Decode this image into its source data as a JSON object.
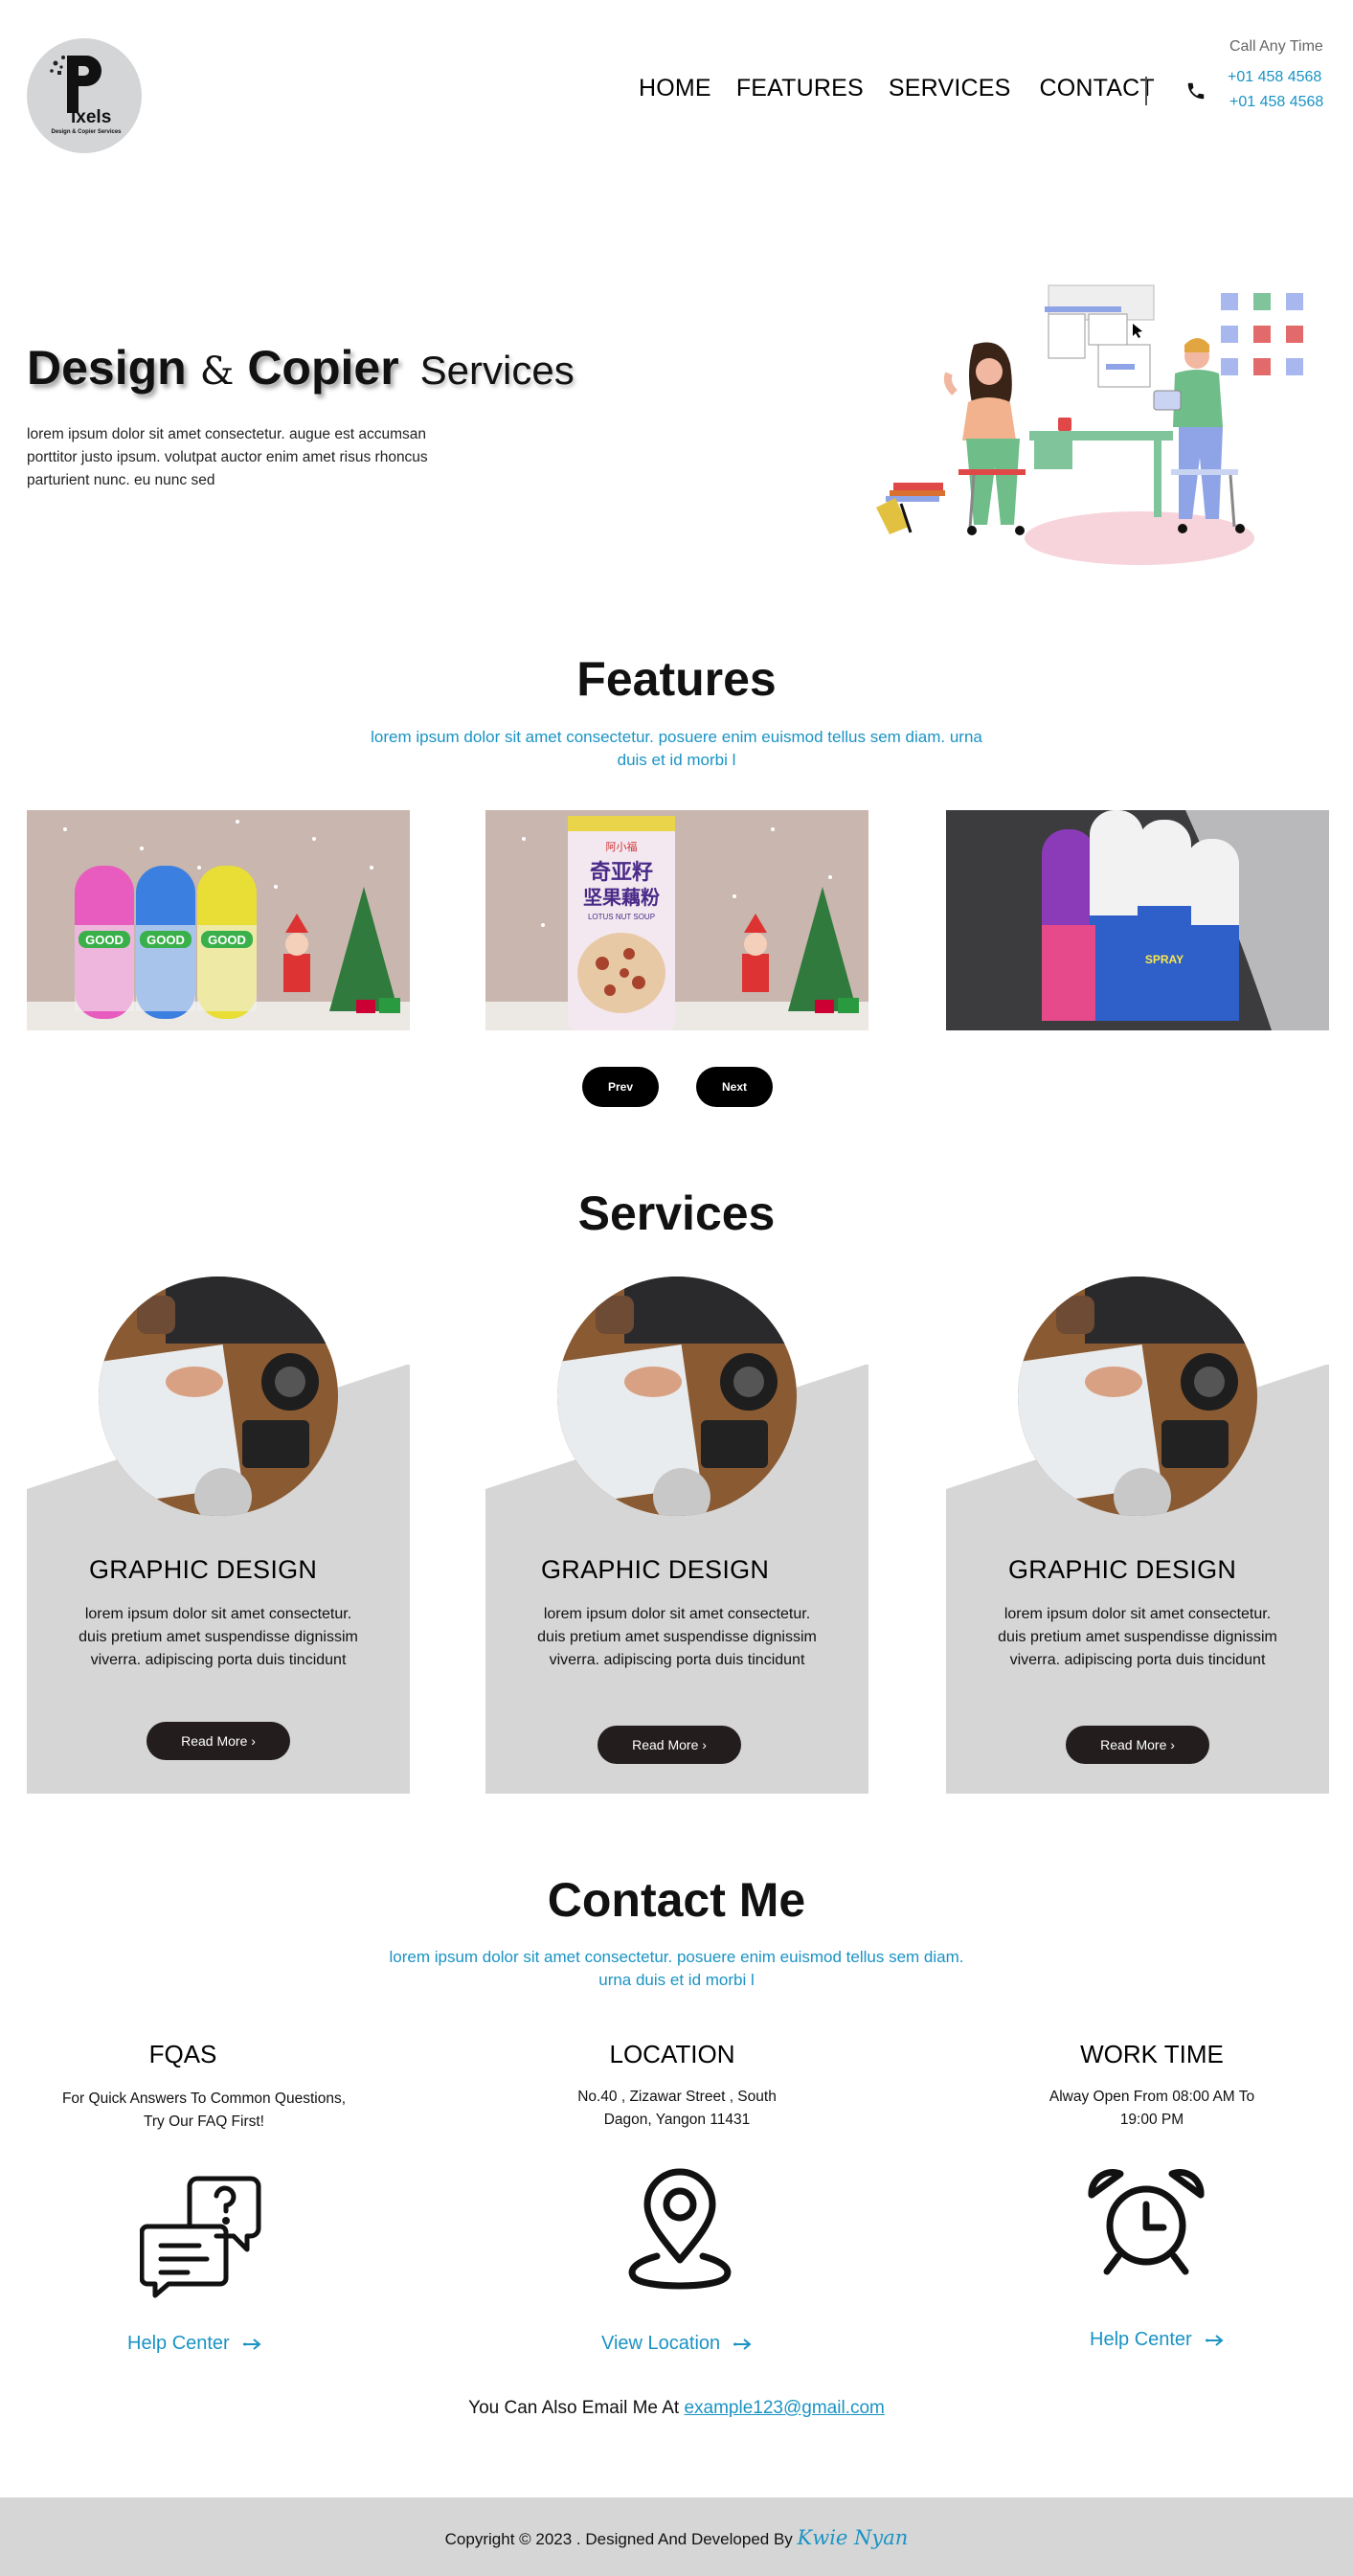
{
  "header": {
    "logo_text": "ixels",
    "logo_tagline": "Design & Copier Services",
    "nav": [
      "HOME",
      "FEATURES",
      "SERVICES",
      "CONTACT"
    ],
    "call_label": "Call Any Time",
    "phones": [
      "+01 458 4568",
      "+01 458 4568"
    ],
    "icons": {
      "phone": "phone-icon"
    }
  },
  "hero": {
    "title_word1": "Design",
    "title_amp": "&",
    "title_word2": "Copier",
    "title_word3": "Services",
    "description": "lorem ipsum dolor sit amet consectetur. augue est accumsan porttitor justo ipsum. volutpat auctor enim amet risus rhoncus parturient nunc. eu nunc sed"
  },
  "features": {
    "title": "Features",
    "subtitle": "lorem ipsum dolor sit amet consectetur. posuere enim euismod tellus sem diam. urna duis et id morbi l",
    "prev_label": "Prev",
    "next_label": "Next",
    "slides": [
      {
        "label_a": "GOOD",
        "label_b": "GOOD",
        "label_c": "GOOD"
      },
      {
        "can_title": "奇亚籽",
        "can_sub": "坚果藕粉",
        "can_en": "LOTUS NUT SOUP"
      },
      {
        "bottle_text": "SPRAY"
      }
    ]
  },
  "services": {
    "title": "Services",
    "cards": [
      {
        "title": "GRAPHIC DESIGN",
        "desc": "lorem ipsum dolor sit amet consectetur. duis pretium amet suspendisse dignissim viverra. adipiscing porta duis tincidunt",
        "button": "Read More ›"
      },
      {
        "title": "GRAPHIC DESIGN",
        "desc": "lorem ipsum dolor sit amet consectetur. duis pretium amet suspendisse dignissim viverra. adipiscing porta duis tincidunt",
        "button": "Read More ›"
      },
      {
        "title": "GRAPHIC DESIGN",
        "desc": "lorem ipsum dolor sit amet consectetur. duis pretium amet suspendisse dignissim viverra. adipiscing porta duis tincidunt",
        "button": "Read More ›"
      }
    ]
  },
  "contact": {
    "title": "Contact Me",
    "subtitle": "lorem ipsum dolor sit amet consectetur. posuere enim euismod tellus sem diam. urna duis et id morbi l",
    "columns": [
      {
        "heading": "FQAS",
        "text": "For Quick Answers To Common Questions, Try Our FAQ First!",
        "link": "Help Center",
        "icon": "faq-chat-icon"
      },
      {
        "heading": "LOCATION",
        "text": "No.40 ,  Zizawar Street , South Dagon, Yangon 11431",
        "link": "View Location",
        "icon": "location-pin-icon"
      },
      {
        "heading": "WORK TIME",
        "text": "Alway Open From 08:00 AM To 19:00 PM",
        "link": "Help Center",
        "icon": "alarm-clock-icon"
      }
    ],
    "email_prefix": "You Can Also Email Me At",
    "email": "example123@gmail.com"
  },
  "footer": {
    "copyright": "Copyright © 2023 . Designed And Developed By",
    "author": "Kwie Nyan"
  },
  "colors": {
    "accent": "#1a93c4",
    "card_bg": "#d6d6d6",
    "button_dark": "#231d1d",
    "footer_bg": "#d6d6d6"
  }
}
